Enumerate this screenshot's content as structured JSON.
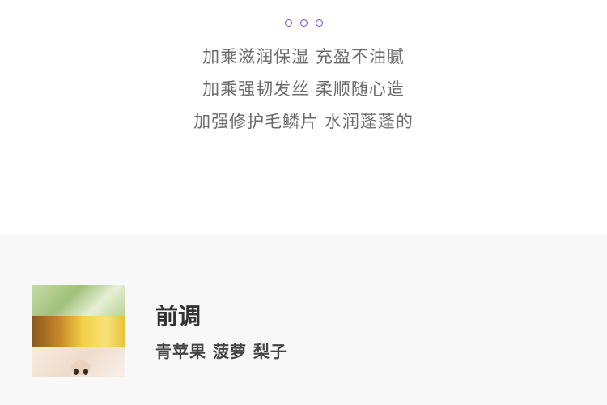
{
  "feature_lines": [
    "加乘滋润保湿 充盈不油腻",
    "加乘强韧发丝 柔顺随心造",
    "加强修护毛鳞片 水润蓬蓬的"
  ],
  "note": {
    "heading": "前调",
    "ingredients": "青苹果 菠萝 梨子"
  },
  "colors": {
    "accent": "#7e4ad6",
    "body_text": "#6b6b6b",
    "heading_text": "#333333",
    "section_bg": "#f8f8f8"
  }
}
